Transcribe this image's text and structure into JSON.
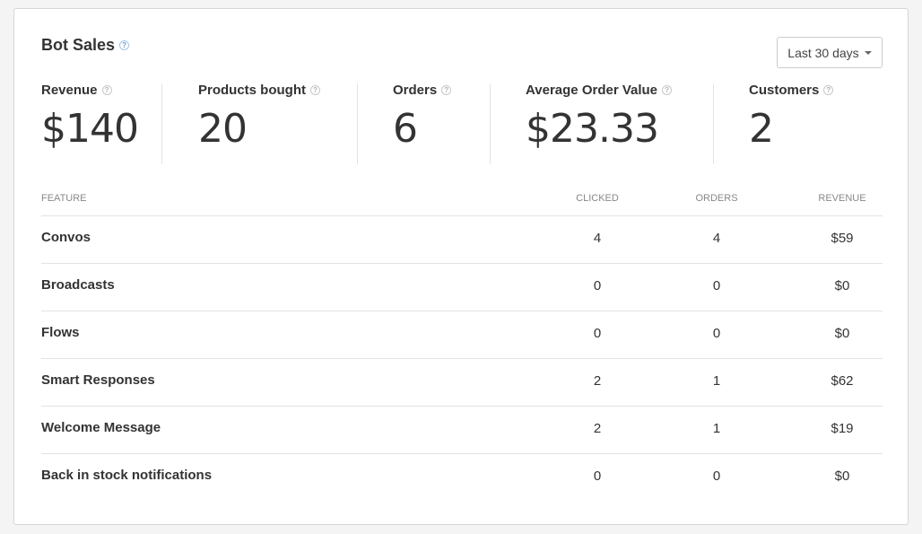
{
  "card": {
    "title": "Bot Sales",
    "help_glyph": "?",
    "date_range": "Last 30 days"
  },
  "stats": [
    {
      "label": "Revenue",
      "value": "$140"
    },
    {
      "label": "Products bought",
      "value": "20"
    },
    {
      "label": "Orders",
      "value": "6"
    },
    {
      "label": "Average Order Value",
      "value": "$23.33"
    },
    {
      "label": "Customers",
      "value": "2"
    }
  ],
  "table": {
    "columns": [
      "FEATURE",
      "CLICKED",
      "ORDERS",
      "REVENUE"
    ],
    "rows": [
      {
        "feature": "Convos",
        "clicked": "4",
        "orders": "4",
        "revenue": "$59"
      },
      {
        "feature": "Broadcasts",
        "clicked": "0",
        "orders": "0",
        "revenue": "$0"
      },
      {
        "feature": "Flows",
        "clicked": "0",
        "orders": "0",
        "revenue": "$0"
      },
      {
        "feature": "Smart Responses",
        "clicked": "2",
        "orders": "1",
        "revenue": "$62"
      },
      {
        "feature": "Welcome Message",
        "clicked": "2",
        "orders": "1",
        "revenue": "$19"
      },
      {
        "feature": "Back in stock notifications",
        "clicked": "0",
        "orders": "0",
        "revenue": "$0"
      }
    ]
  },
  "colors": {
    "help_blue": "#6d9fd2",
    "divider": "#e3e3e3",
    "text": "#333333"
  }
}
